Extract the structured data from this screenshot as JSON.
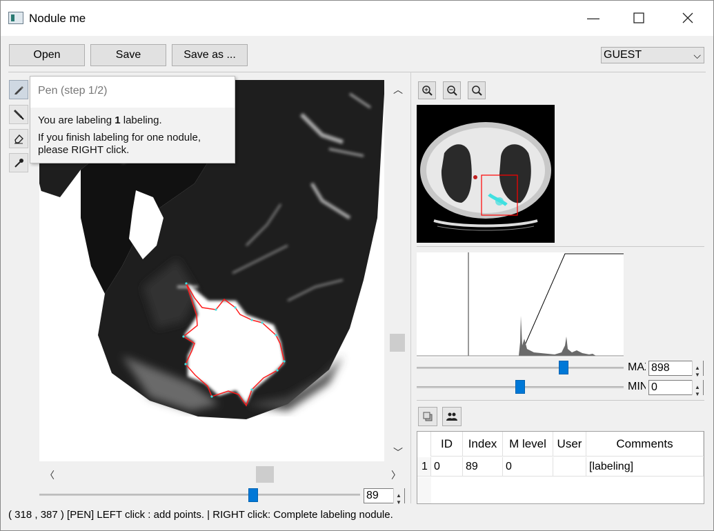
{
  "window": {
    "title": "Nodule me",
    "minimize": "—",
    "maximize": "☐",
    "close": "✕"
  },
  "toolbar": {
    "open_label": "Open",
    "save_label": "Save",
    "save_as_label": "Save as ...",
    "user": "GUEST"
  },
  "tools": [
    "pen-icon",
    "brush-icon",
    "eraser-icon",
    "picker-icon"
  ],
  "tooltip": {
    "title": "Pen (step 1/2)",
    "line1_pre": "You are labeling",
    "line1_count": "1",
    "line1_post": "labeling.",
    "line2": "If you finish labeling for one nodule,",
    "line3": "please RIGHT  click."
  },
  "slice": {
    "value": "89",
    "fraction": 0.64
  },
  "levels": {
    "max_label": "MAX",
    "max_value": "898",
    "max_fraction": 0.71,
    "min_label": "MIN",
    "min_value": "0",
    "min_fraction": 0.5
  },
  "table": {
    "headers": [
      "ID",
      "Index",
      "M level",
      "User",
      "Comments"
    ],
    "rows": [
      {
        "num": "1",
        "id": "0",
        "index": "89",
        "mlevel": "0",
        "user": "",
        "comments": "[labeling]"
      }
    ]
  },
  "status": "( 318 , 387 )  [PEN] LEFT  click : add points. | RIGHT  click: Complete labeling nodule.",
  "colors": {
    "accent": "#0078d7",
    "contour": "#ff1a1a",
    "roi_box": "#ff0000",
    "points": "#40e0e0"
  }
}
